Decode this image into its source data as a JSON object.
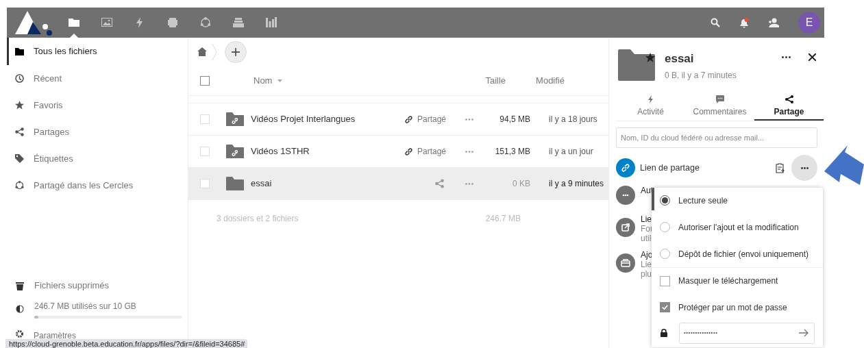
{
  "top_bar": {
    "apps": [
      {
        "kind": "files",
        "selected": true
      },
      {
        "kind": "photos",
        "selected": false
      },
      {
        "kind": "activity",
        "selected": false
      },
      {
        "kind": "gallery",
        "selected": false
      },
      {
        "kind": "circles",
        "selected": false
      },
      {
        "kind": "deck",
        "selected": false
      },
      {
        "kind": "stats",
        "selected": false
      }
    ],
    "avatar": "E"
  },
  "sidebar": {
    "items": [
      {
        "kind": "folder",
        "label": "Tous les fichiers",
        "selected": true
      },
      {
        "kind": "clock",
        "label": "Récent",
        "selected": false
      },
      {
        "kind": "star",
        "label": "Favoris",
        "selected": false
      },
      {
        "kind": "share",
        "label": "Partages",
        "selected": false
      },
      {
        "kind": "tag",
        "label": "Étiquettes",
        "selected": false
      },
      {
        "kind": "circles",
        "label": "Partagé dans les Cercles",
        "selected": false
      }
    ],
    "trash": "Fichiers supprimés",
    "storage": {
      "label": "246.7 MB utilisés sur 10 GB",
      "level": 0.03
    },
    "settings": "Paramètres"
  },
  "files": {
    "select_all": {
      "checked": false
    },
    "columns": [
      "Nom",
      "Taille",
      "Modifié"
    ],
    "rows": [
      {
        "kind": "shared-folder",
        "name": "Vidéos Projet Interlangues",
        "share_label": "Partagé",
        "size": "94,5 MB",
        "modified": "il y a 18 jours",
        "checked": false,
        "selected": false
      },
      {
        "kind": "shared-folder",
        "name": "Vidéos 1STHR",
        "share_label": "Partagé",
        "size": "151,3 MB",
        "modified": "il y a un jour",
        "checked": false,
        "selected": false
      },
      {
        "kind": "folder",
        "name": "essai",
        "size": "0 KB",
        "modified": "il y a 9 minutes",
        "checked": false,
        "selected": true
      }
    ],
    "summary": {
      "text": "3 dossiers et 2 fichiers",
      "size": "246.7 MB"
    }
  },
  "details": {
    "title": "essai",
    "subtitle": "0 B, il y a 7 minutes",
    "tabs": [
      {
        "kind": "activity",
        "label": "Activité",
        "selected": false
      },
      {
        "kind": "comments",
        "label": "Commentaires",
        "selected": false
      },
      {
        "kind": "share",
        "label": "Partage",
        "selected": true
      }
    ],
    "share_placeholder": "Nom, ID du cloud fédéré ou adresse mail...",
    "link_share": "Lien de partage",
    "entries": [
      {
        "kind": "more",
        "lines": [
          "Aut"
        ]
      },
      {
        "kind": "external",
        "lines": [
          "Lie",
          "For",
          "util"
        ]
      },
      {
        "kind": "collection",
        "lines": [
          "Ajo",
          "Lie",
          "plu"
        ]
      }
    ],
    "menu": {
      "options": [
        {
          "kind": "radio",
          "label": "Lecture seule",
          "checked": true
        },
        {
          "kind": "radio",
          "label": "Autoriser l'ajout et la modification",
          "checked": false
        },
        {
          "kind": "radio",
          "label": "Dépôt de fichier (envoi uniquement)",
          "checked": false
        },
        {
          "kind": "checkbox",
          "label": "Masquer le téléchargement",
          "checked": false
        },
        {
          "kind": "checkbox",
          "label": "Protéger par un mot de passe",
          "checked": true
        }
      ],
      "password": "•••••••••••••••"
    }
  },
  "status_url": "https://cloud-grenoble.beta.education.fr/apps/files/?dir=/&fileid=34685#"
}
